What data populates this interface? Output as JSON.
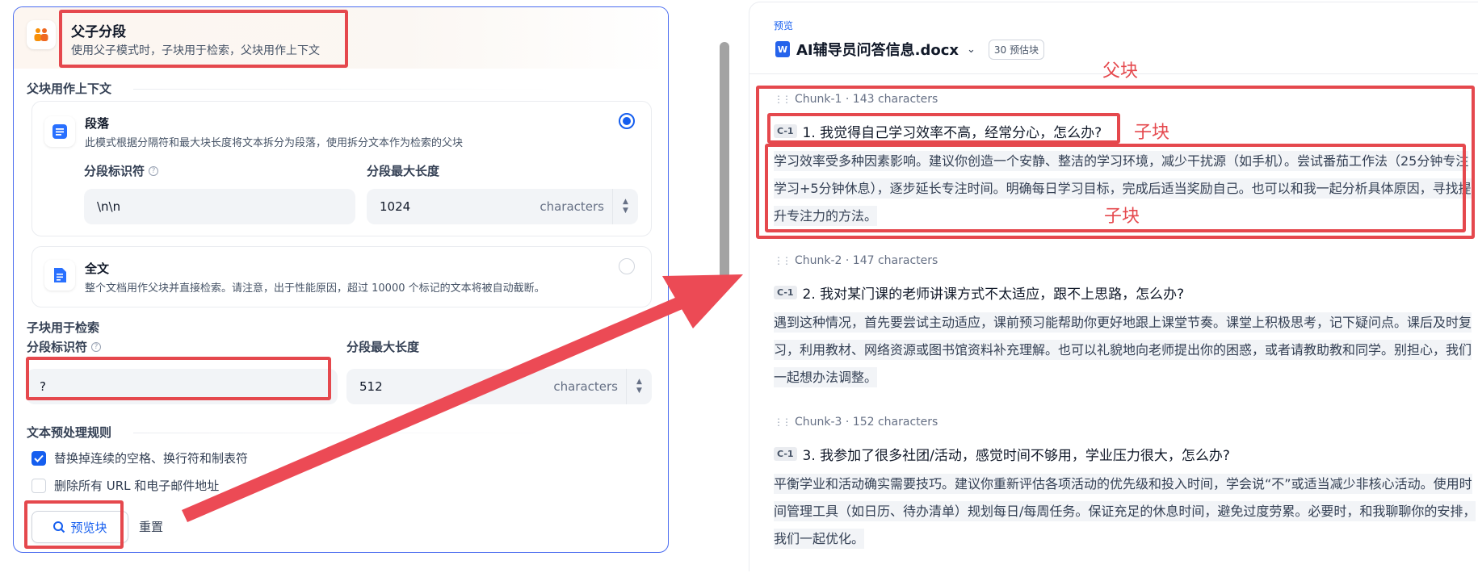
{
  "left": {
    "header": {
      "title": "父子分段",
      "subtitle": "使用父子模式时，子块用于检索，父块用作上下文"
    },
    "parent_section_label": "父块用作上下文",
    "paragraph_option": {
      "title": "段落",
      "desc": "此模式根据分隔符和最大块长度将文本拆分为段落，使用拆分文本作为检索的父块",
      "selected": true,
      "separator_label": "分段标识符",
      "separator_value": "\\n\\n",
      "maxlen_label": "分段最大长度",
      "maxlen_value": "1024",
      "maxlen_unit": "characters"
    },
    "fulltext_option": {
      "title": "全文",
      "desc": "整个文档用作父块并直接检索。请注意，出于性能原因，超过 10000 个标记的文本将被自动截断。",
      "selected": false
    },
    "child_section_label": "子块用于检索",
    "child": {
      "separator_label": "分段标识符",
      "separator_value": "?",
      "maxlen_label": "分段最大长度",
      "maxlen_value": "512",
      "maxlen_unit": "characters"
    },
    "preprocess_label": "文本预处理规则",
    "rules": [
      {
        "label": "替换掉连续的空格、换行符和制表符",
        "checked": true
      },
      {
        "label": "删除所有 URL 和电子邮件地址",
        "checked": false
      }
    ],
    "preview_button": "预览块",
    "reset_button": "重置"
  },
  "right": {
    "kicker": "预览",
    "doc_title": "AI辅导员问答信息.docx",
    "estimate_badge": "30 预估块",
    "chunks": [
      {
        "meta": "Chunk-1 · 143 characters",
        "badge": "C-1",
        "question": "1. 我觉得自己学习效率不高，经常分心，怎么办?",
        "answer": "学习效率受多种因素影响。建议你创造一个安静、整洁的学习环境，减少干扰源（如手机）。尝试番茄工作法（25分钟专注学习+5分钟休息），逐步延长专注时间。明确每日学习目标，完成后适当奖励自己。也可以和我一起分析具体原因，寻找提升专注力的方法。"
      },
      {
        "meta": "Chunk-2 · 147 characters",
        "badge": "C-1",
        "question": "2. 我对某门课的老师讲课方式不太适应，跟不上思路，怎么办?",
        "answer": "遇到这种情况，首先要尝试主动适应，课前预习能帮助你更好地跟上课堂节奏。课堂上积极思考，记下疑问点。课后及时复习，利用教材、网络资源或图书馆资料补充理解。也可以礼貌地向老师提出你的困惑，或者请教助教和同学。别担心，我们一起想办法调整。"
      },
      {
        "meta": "Chunk-3 · 152 characters",
        "badge": "C-1",
        "question": "3. 我参加了很多社团/活动，感觉时间不够用，学业压力很大，怎么办?",
        "answer": "平衡学业和活动确实需要技巧。建议你重新评估各项活动的优先级和投入时间，学会说“不”或适当减少非核心活动。使用时间管理工具（如日历、待办清单）规划每日/每周任务。保证充足的休息时间，避免过度劳累。必要时，和我聊聊你的安排，我们一起优化。"
      }
    ]
  },
  "annotations": {
    "parent_label": "父块",
    "child_label_1": "子块",
    "child_label_2": "子块"
  },
  "colors": {
    "accent": "#155eef",
    "annotation_red": "#e5484d",
    "panel_border": "#4a6cf0"
  }
}
